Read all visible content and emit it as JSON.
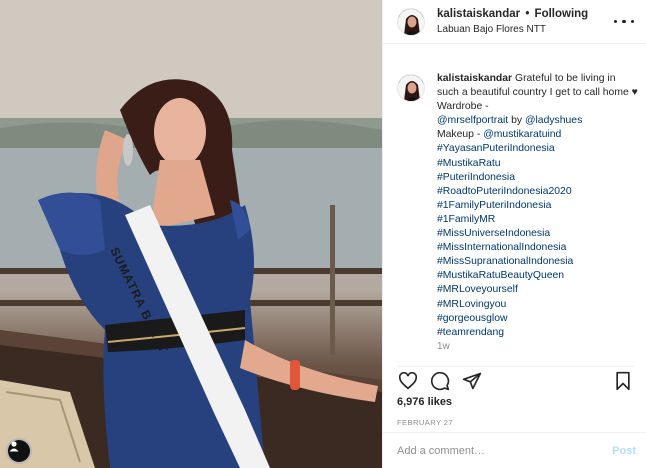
{
  "post": {
    "username": "kalistaiskandar",
    "separator": "•",
    "follow_status": "Following",
    "location": "Labuan Bajo Flores NTT",
    "caption_intro": "Grateful to be living in such a beautiful country I get to call home",
    "caption_heart": "♥",
    "caption_wardrobe": "Wardrobe -",
    "mention_1": "@mrselfportrait",
    "by_text": "by",
    "mention_2": "@ladyshues",
    "makeup_text": "Makeup -",
    "mention_3": "@mustikaratuind",
    "hashtags": [
      "#YayasanPuteriIndonesia",
      "#MustikaRatu",
      "#PuteriIndonesia",
      "#RoadtoPuteriIndonesia2020",
      "#1FamilyPuteriIndonesia",
      "#1FamilyMR",
      "#MissUniverseIndonesia",
      "#MissInternationalIndonesia",
      "#MissSupranationalIndonesia",
      "#MustikaRatuBeautyQueen",
      "#MRLoveyourself",
      "#MRLovingyou",
      "#gorgeousglow",
      "#teamrendang"
    ],
    "truncated_marker": "1w",
    "likes": "6,976 likes",
    "date": "FEBRUARY 27",
    "sash_text": "SUMATRA BARAT"
  },
  "comment": {
    "placeholder": "Add a comment…",
    "post_label": "Post"
  },
  "icons": {
    "like": "heart-icon",
    "comment": "comment-icon",
    "share": "share-icon",
    "save": "bookmark-icon",
    "more": "more-options-icon"
  },
  "colors": {
    "link": "#00376b",
    "muted": "#8e8e8e",
    "post_disabled": "#b2dffc",
    "text": "#262626"
  }
}
